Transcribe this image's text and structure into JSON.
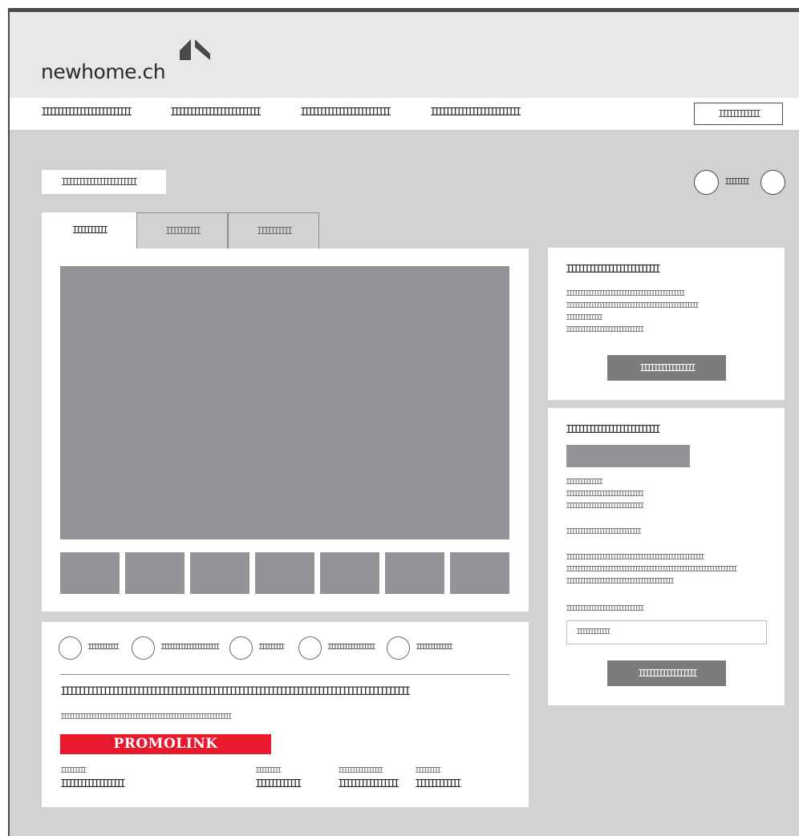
{
  "colors": {
    "frame": "#4a4a4c",
    "background": "#d1d2d4",
    "header": "#e7e8e9",
    "image_placeholder": "#939497",
    "button": "#7b7c7e",
    "promo": "#e8192c"
  },
  "header": {
    "logo_text": "newhome.ch",
    "logo_icon": "house-roof-icon"
  },
  "nav": {
    "items": [
      "IIIIIIIIIIIIIIIIIIIIIIII",
      "IIIIIIIIIIIIIIIIIIIIIIII",
      "IIIIIIIIIIIIIIIIIIIIIIII",
      "IIIIIIIIIIIIIIIIIIIIIIII"
    ],
    "button_label": "IIIIIIIIIIII"
  },
  "breadcrumb": {
    "label": "IIIIIIIIIIIIIIIIIIIIII"
  },
  "pager": {
    "label": "IIIIIIII"
  },
  "tabs": [
    "IIIIIIIIII",
    "IIIIIIIIII",
    "IIIIIIIIII"
  ],
  "contact_card": {
    "title": "IIIIIIIIIIIIIIIIIIIIIIIII",
    "lines": [
      "IIIIIIIIIIIIIIIIIIIIIIIIIIIIIIIIIIIIIIIIIII",
      "IIIIIIIIIIIIIIIIIIIIIIIIIIIIIIIIIIIIIIIIIIIIIIII",
      "IIIIIIIIIIIII",
      "IIIIIIIIIIIIIIIIIIIIIIIIIIII"
    ],
    "button_label": "IIIIIIIIIIIIIIII"
  },
  "form_card": {
    "title": "IIIIIIIIIIIIIIIIIIIIIIIII",
    "group1": [
      "IIIIIIIIIIIII",
      "IIIIIIIIIIIIIIIIIIIIIIIIIIII",
      "IIIIIIIIIIIIIIIIIIIIIIIIIIII"
    ],
    "line2": "IIIIIIIIIIIIIIIIIIIIIIIIIII",
    "group3": [
      "IIIIIIIIIIIIIIIIIIIIIIIIIIIIIIIIIIIIIIIIIIIIIIIIII",
      "IIIIIIIIIIIIIIIIIIIIIIIIIIIIIIIIIIIIIIIIIIIIIIIIIIIIIIIIIIIIII",
      "IIIIIIIIIIIIIIIIIIIIIIIIIIIIIIIIIIIIIII"
    ],
    "input_label": "IIIIIIIIIIIIIIIIIIIIIIIIIIII",
    "input_value": "IIIIIIIIIIII",
    "button_label": "IIIIIIIIIIIIIIIII"
  },
  "details": {
    "features": [
      "IIIIIIIIIII",
      "IIIIIIIIIIIIIIIIIIIII",
      "IIIIIIIII",
      "IIIIIIIIIIIIIIIII",
      "IIIIIIIIIIIII"
    ],
    "title": "IIIIIIIIIIIIIIIIIIIIIIIIIIIIIIIIIIIIIIIIIIIIIIIIIIIIIIIIIIIIIIIIIIIIIIIIIIIIIIIIIII",
    "subtitle": "IIIIIIIIIIIIIIIIIIIIIIIIIIIIIIIIIIIIIIIIIIIIIIIIIIIIIIIIIIIIII",
    "promo_label": "PROMOLINK",
    "facts": [
      {
        "label": "IIIIIIIII",
        "value": "IIIIIIIIIIIIIIIII"
      },
      {
        "label": "IIIIIIIII",
        "value": "IIIIIIIIIIII"
      },
      {
        "label": "IIIIIIIIIIIIIIII",
        "value": "IIIIIIIIIIIIIIII"
      },
      {
        "label": "IIIIIIIII",
        "value": "IIIIIIIIIIII"
      }
    ]
  }
}
